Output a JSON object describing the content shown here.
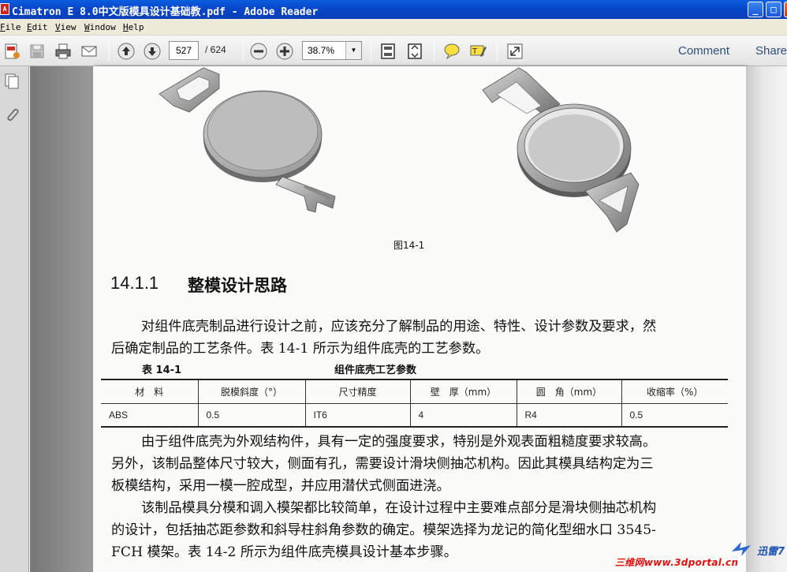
{
  "window": {
    "title": "Cimatron E 8.0中文版模具设计基础教.pdf - Adobe Reader",
    "app_icon_label": "A",
    "minimize_label": "_",
    "maximize_label": "□",
    "close_label": "×"
  },
  "menu": {
    "items": [
      "File",
      "Edit",
      "View",
      "Window",
      "Help"
    ]
  },
  "toolbar": {
    "page_current": "527",
    "page_total": "/ 624",
    "zoom": "38.7%",
    "zoom_dropdown_glyph": "▼",
    "comment_label": "Comment",
    "share_label": "Share",
    "icons": [
      "create-pdf-icon",
      "save-icon",
      "print-icon",
      "email-icon",
      "previous-page-icon",
      "next-page-icon",
      "zoom-out-icon",
      "zoom-in-icon",
      "fit-page-icon",
      "fit-width-icon",
      "sticky-note-icon",
      "highlight-icon",
      "full-screen-icon"
    ]
  },
  "left_nav": {
    "icons": [
      "pages-panel-icon",
      "attachments-icon"
    ]
  },
  "document": {
    "figure_caption": "图14-1",
    "section_number": "14.1.1",
    "section_title": "整模设计思路",
    "paragraph1": [
      "对组件底壳制品进行设计之前，应该充分了解制品的用途、特性、设计参数及要求，然",
      "后确定制品的工艺条件。表 14-1 所示为组件底壳的工艺参数。"
    ],
    "table": {
      "label": "表 14-1",
      "title": "组件底壳工艺参数",
      "headers": [
        "材　料",
        "脱模斜度（°）",
        "尺寸精度",
        "壁　厚（mm）",
        "圆　角（mm）",
        "收缩率（%）"
      ],
      "rows": [
        [
          "ABS",
          "0.5",
          "IT6",
          "4",
          "R4",
          "0.5"
        ]
      ]
    },
    "paragraph2": [
      "由于组件底壳为外观结构件，具有一定的强度要求，特别是外观表面粗糙度要求较高。",
      "另外，该制品整体尺寸较大，侧面有孔，需要设计滑块侧抽芯机构。因此其模具结构定为三",
      "板模结构，采用一模一腔成型，并应用潜伏式侧面进浇。"
    ],
    "paragraph3": [
      "该制品模具分模和调入模架都比较简单，在设计过程中主要难点部分是滑块侧抽芯机构",
      "的设计，包括抽芯距参数和斜导柱斜角参数的确定。模架选择为龙记的简化型细水口 3545-",
      "FCH 模架。表 14-2 所示为组件底壳模具设计基本步骤。"
    ]
  },
  "watermarks": {
    "xunlei": "迅雷7",
    "site": "三维网www.3dportal.cn"
  }
}
